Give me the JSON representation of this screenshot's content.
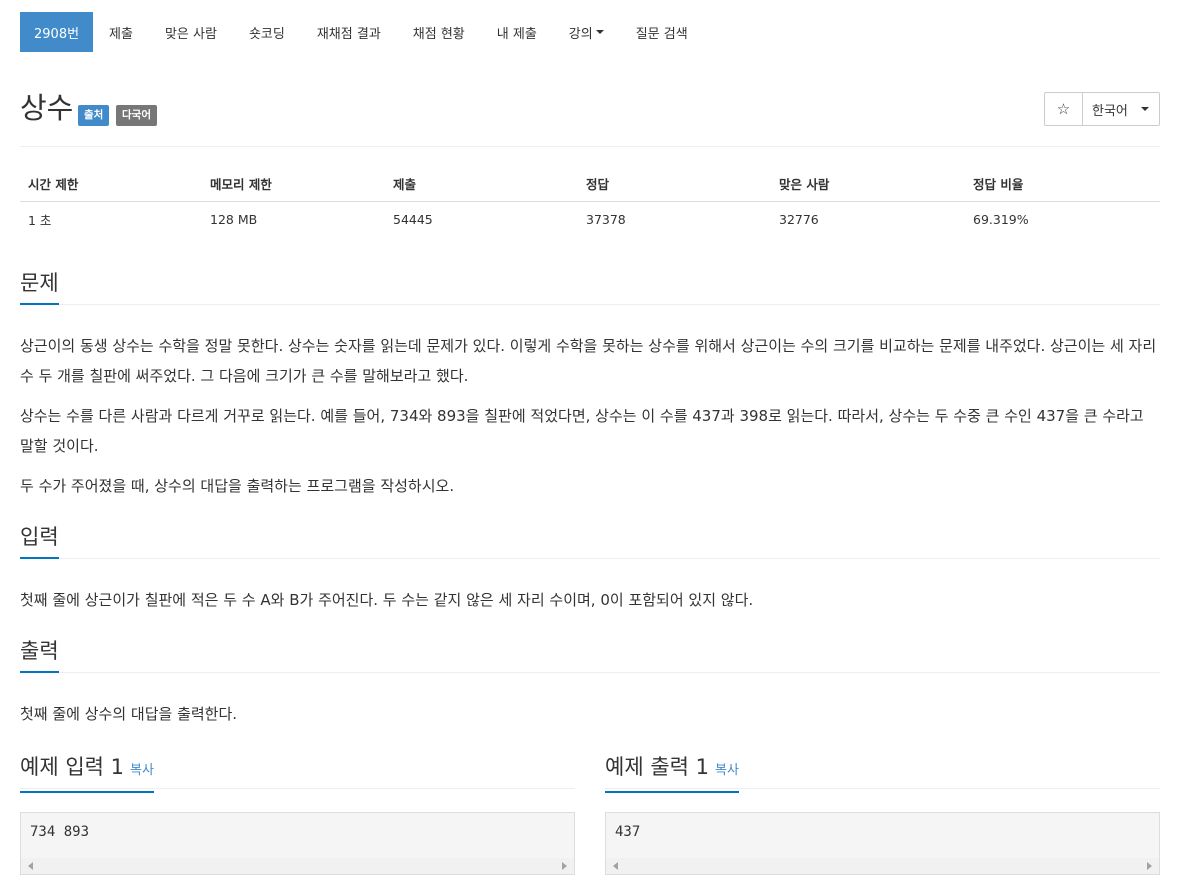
{
  "menu": {
    "tabs": [
      {
        "label": "2908번",
        "active": true
      },
      {
        "label": "제출"
      },
      {
        "label": "맞은 사람"
      },
      {
        "label": "숏코딩"
      },
      {
        "label": "재채점 결과"
      },
      {
        "label": "채점 현황"
      },
      {
        "label": "내 제출"
      },
      {
        "label": "강의",
        "dropdown": true
      },
      {
        "label": "질문 검색"
      }
    ]
  },
  "problem": {
    "title": "상수",
    "labels": {
      "source": "출처",
      "multilang": "다국어"
    },
    "star_icon": "☆",
    "language": "한국어"
  },
  "info": {
    "headers": [
      "시간 제한",
      "메모리 제한",
      "제출",
      "정답",
      "맞은 사람",
      "정답 비율"
    ],
    "values": [
      "1 초",
      "128 MB",
      "54445",
      "37378",
      "32776",
      "69.319%"
    ]
  },
  "sections": {
    "description": {
      "heading": "문제",
      "paragraphs": [
        "상근이의 동생 상수는 수학을 정말 못한다. 상수는 숫자를 읽는데 문제가 있다. 이렇게 수학을 못하는 상수를 위해서 상근이는 수의 크기를 비교하는 문제를 내주었다. 상근이는 세 자리 수 두 개를 칠판에 써주었다. 그 다음에 크기가 큰 수를 말해보라고 했다.",
        "상수는 수를 다른 사람과 다르게 거꾸로 읽는다. 예를 들어, 734와 893을 칠판에 적었다면, 상수는 이 수를 437과 398로 읽는다. 따라서, 상수는 두 수중 큰 수인 437을 큰 수라고 말할 것이다.",
        "두 수가 주어졌을 때, 상수의 대답을 출력하는 프로그램을 작성하시오."
      ]
    },
    "input": {
      "heading": "입력",
      "text": "첫째 줄에 상근이가 칠판에 적은 두 수 A와 B가 주어진다. 두 수는 같지 않은 세 자리 수이며, 0이 포함되어 있지 않다."
    },
    "output": {
      "heading": "출력",
      "text": "첫째 줄에 상수의 대답을 출력한다."
    }
  },
  "samples": {
    "input": {
      "heading": "예제 입력 1",
      "copy": "복사",
      "data": "734 893"
    },
    "output": {
      "heading": "예제 출력 1",
      "copy": "복사",
      "data": "437"
    }
  }
}
